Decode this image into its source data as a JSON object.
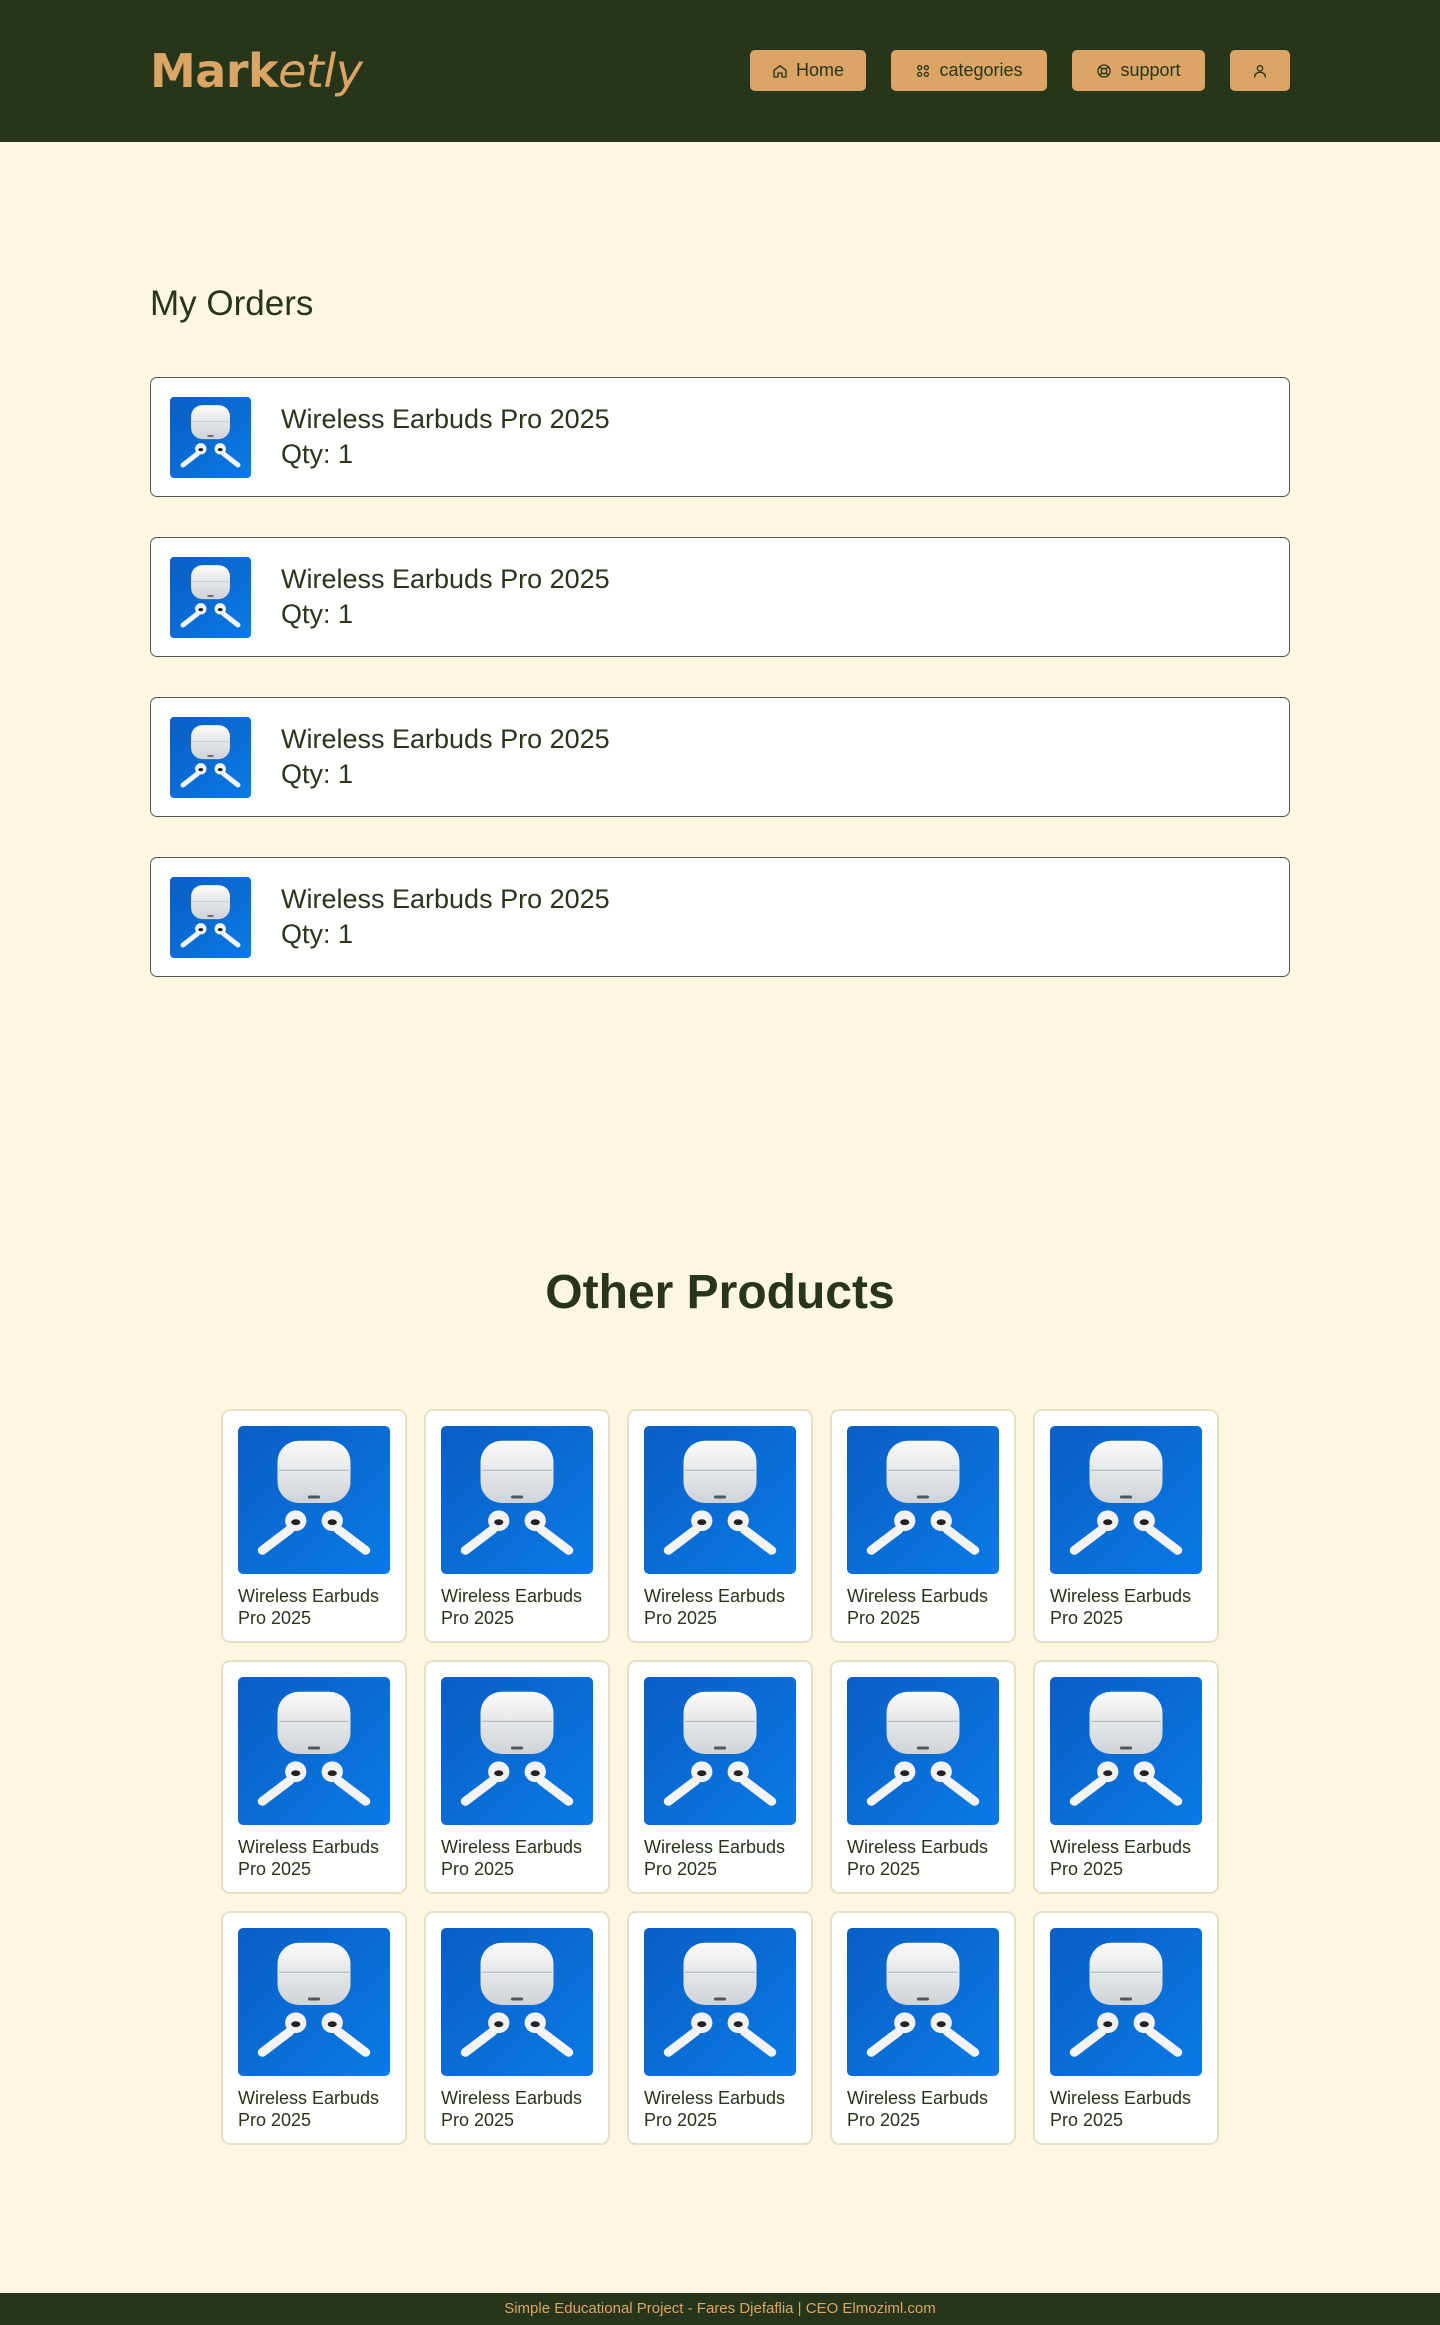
{
  "brand": {
    "logo_bold": "Mark",
    "logo_italic": "etly"
  },
  "nav": {
    "home_label": "Home",
    "categories_label": "categories",
    "support_label": "support",
    "home_icon": "home-icon",
    "categories_icon": "grid-icon",
    "support_icon": "lifebuoy-icon",
    "user_icon": "user-icon"
  },
  "orders": {
    "title": "My Orders",
    "items": [
      {
        "name": "Wireless Earbuds Pro 2025",
        "qty": "Qty: 1"
      },
      {
        "name": "Wireless Earbuds Pro 2025",
        "qty": "Qty: 1"
      },
      {
        "name": "Wireless Earbuds Pro 2025",
        "qty": "Qty: 1"
      },
      {
        "name": "Wireless Earbuds Pro 2025",
        "qty": "Qty: 1"
      }
    ]
  },
  "other_products": {
    "title": "Other Products",
    "items": [
      {
        "name": "Wireless Earbuds Pro 2025"
      },
      {
        "name": "Wireless Earbuds Pro 2025"
      },
      {
        "name": "Wireless Earbuds Pro 2025"
      },
      {
        "name": "Wireless Earbuds Pro 2025"
      },
      {
        "name": "Wireless Earbuds Pro 2025"
      },
      {
        "name": "Wireless Earbuds Pro 2025"
      },
      {
        "name": "Wireless Earbuds Pro 2025"
      },
      {
        "name": "Wireless Earbuds Pro 2025"
      },
      {
        "name": "Wireless Earbuds Pro 2025"
      },
      {
        "name": "Wireless Earbuds Pro 2025"
      },
      {
        "name": "Wireless Earbuds Pro 2025"
      },
      {
        "name": "Wireless Earbuds Pro 2025"
      },
      {
        "name": "Wireless Earbuds Pro 2025"
      },
      {
        "name": "Wireless Earbuds Pro 2025"
      },
      {
        "name": "Wireless Earbuds Pro 2025"
      }
    ]
  },
  "footer": {
    "text": "Simple Educational Project - Fares Djefaflia | CEO Elmoziml.com"
  },
  "colors": {
    "header_bg": "#27351a",
    "accent": "#dba665",
    "page_bg": "#fcf7de",
    "product_bg": "#0a6fd9"
  }
}
